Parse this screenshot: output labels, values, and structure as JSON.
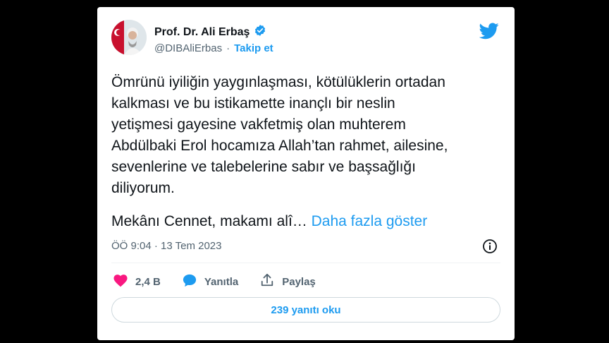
{
  "author": {
    "name": "Prof. Dr. Ali Erbaş",
    "handle": "@DIBAliErbas",
    "separator": "·",
    "follow_label": "Takip et"
  },
  "tweet": {
    "text": "Ömrünü iyiliğin yaygınlaşması, kötülüklerin ortadan\nkalkması ve bu istikamette inançlı bir neslin\nyetişmesi gayesine vakfetmiş olan muhterem\nAbdülbaki Erol hocamıza Allah’tan rahmet, ailesine,\nsevenlerine ve talebelerine sabır ve başsağlığı\ndiliyorum.",
    "truncated_line": "Mekânı Cennet, makamı alî…",
    "show_more_label": "Daha fazla göster",
    "timestamp": "ÖÖ 9:04 · 13 Tem 2023"
  },
  "actions": {
    "like_count": "2,4 B",
    "reply_label": "Yanıtla",
    "share_label": "Paylaş"
  },
  "replies_button_label": "239 yanıtı oku",
  "colors": {
    "accent": "#1d9bf0",
    "like": "#f91880",
    "text": "#0f1419",
    "muted": "#536471",
    "border": "#cfd9de"
  },
  "icons": {
    "verified": "verified-badge-icon",
    "brand": "twitter-bird-icon",
    "info": "info-icon",
    "like": "heart-icon",
    "reply": "speech-bubble-icon",
    "share": "share-icon"
  }
}
